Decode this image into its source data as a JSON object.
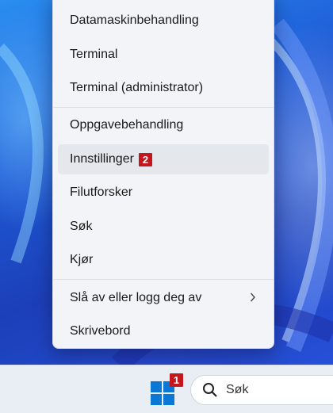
{
  "context_menu": {
    "items": [
      {
        "label": "Datamaskinbehandling"
      },
      {
        "label": "Terminal"
      },
      {
        "label": "Terminal (administrator)"
      },
      {
        "label": "Oppgavebehandling"
      },
      {
        "label": "Innstillinger",
        "badge": "2"
      },
      {
        "label": "Filutforsker"
      },
      {
        "label": "Søk"
      },
      {
        "label": "Kjør"
      },
      {
        "label": "Slå av eller logg deg av",
        "submenu_icon": "chevron-right-icon"
      },
      {
        "label": "Skrivebord"
      }
    ]
  },
  "taskbar": {
    "start_badge": "1",
    "start_icon": "windows-logo-icon",
    "search_label": "Søk",
    "search_icon": "search-icon"
  },
  "colors": {
    "badge": "#c4161c",
    "menu_background": "#f2f4f8",
    "taskbar_background": "#e9edf4",
    "windows_logo": "#0a78d4"
  }
}
